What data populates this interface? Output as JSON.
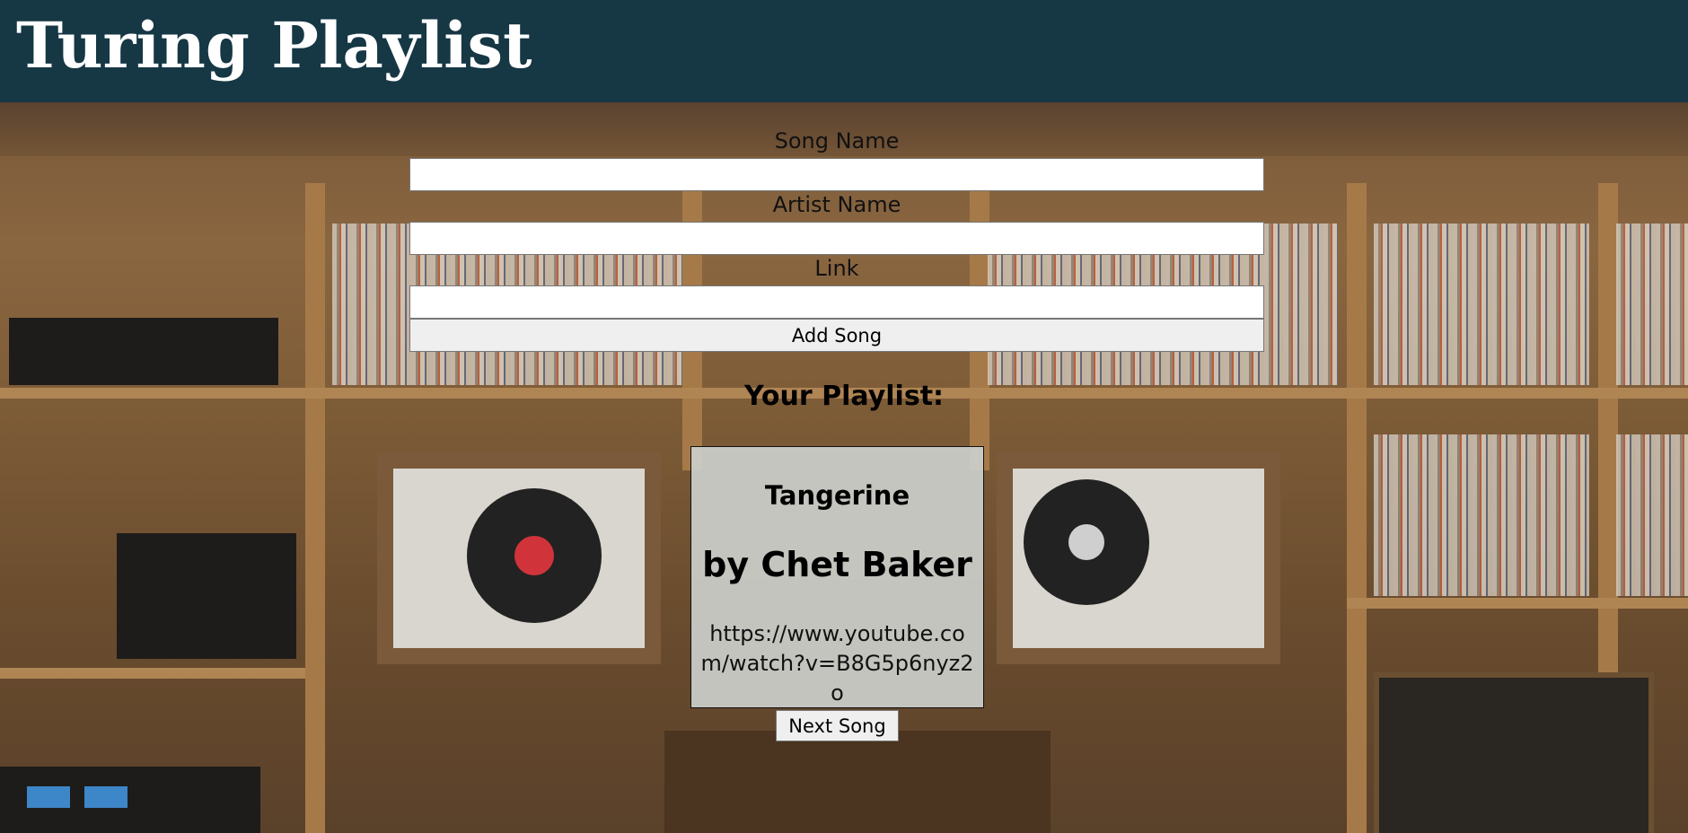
{
  "header": {
    "title": "Turing Playlist"
  },
  "form": {
    "song_label": "Song Name",
    "song_value": "",
    "artist_label": "Artist Name",
    "artist_value": "",
    "link_label": "Link",
    "link_value": "",
    "add_button": "Add Song"
  },
  "playlist": {
    "heading": "Your Playlist:",
    "current": {
      "song": "Tangerine",
      "artist": "by Chet Baker",
      "link": "https://www.youtube.com/watch?v=B8G5p6nyz2o"
    },
    "next_button": "Next Song"
  },
  "colors": {
    "header_bg": "#163744",
    "title_text": "#ffffff",
    "card_bg": "#cdd2ce"
  }
}
